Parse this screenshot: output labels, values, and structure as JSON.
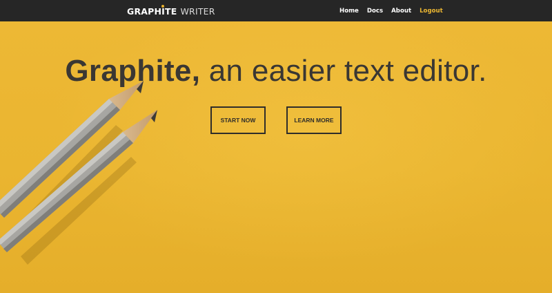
{
  "navbar": {
    "brand_bold": "GRAPHITE",
    "brand_light": "WRITER",
    "links": [
      {
        "label": "Home"
      },
      {
        "label": "Docs"
      },
      {
        "label": "About"
      },
      {
        "label": "Logout"
      }
    ],
    "active_link_color": "#ecb732"
  },
  "hero": {
    "headline_strong": "Graphite,",
    "headline_rest": " an easier text editor.",
    "buttons": [
      {
        "label": "START NOW"
      },
      {
        "label": "LEARN MORE"
      }
    ],
    "background_color": "#ecb732",
    "image": "two-pencils"
  }
}
